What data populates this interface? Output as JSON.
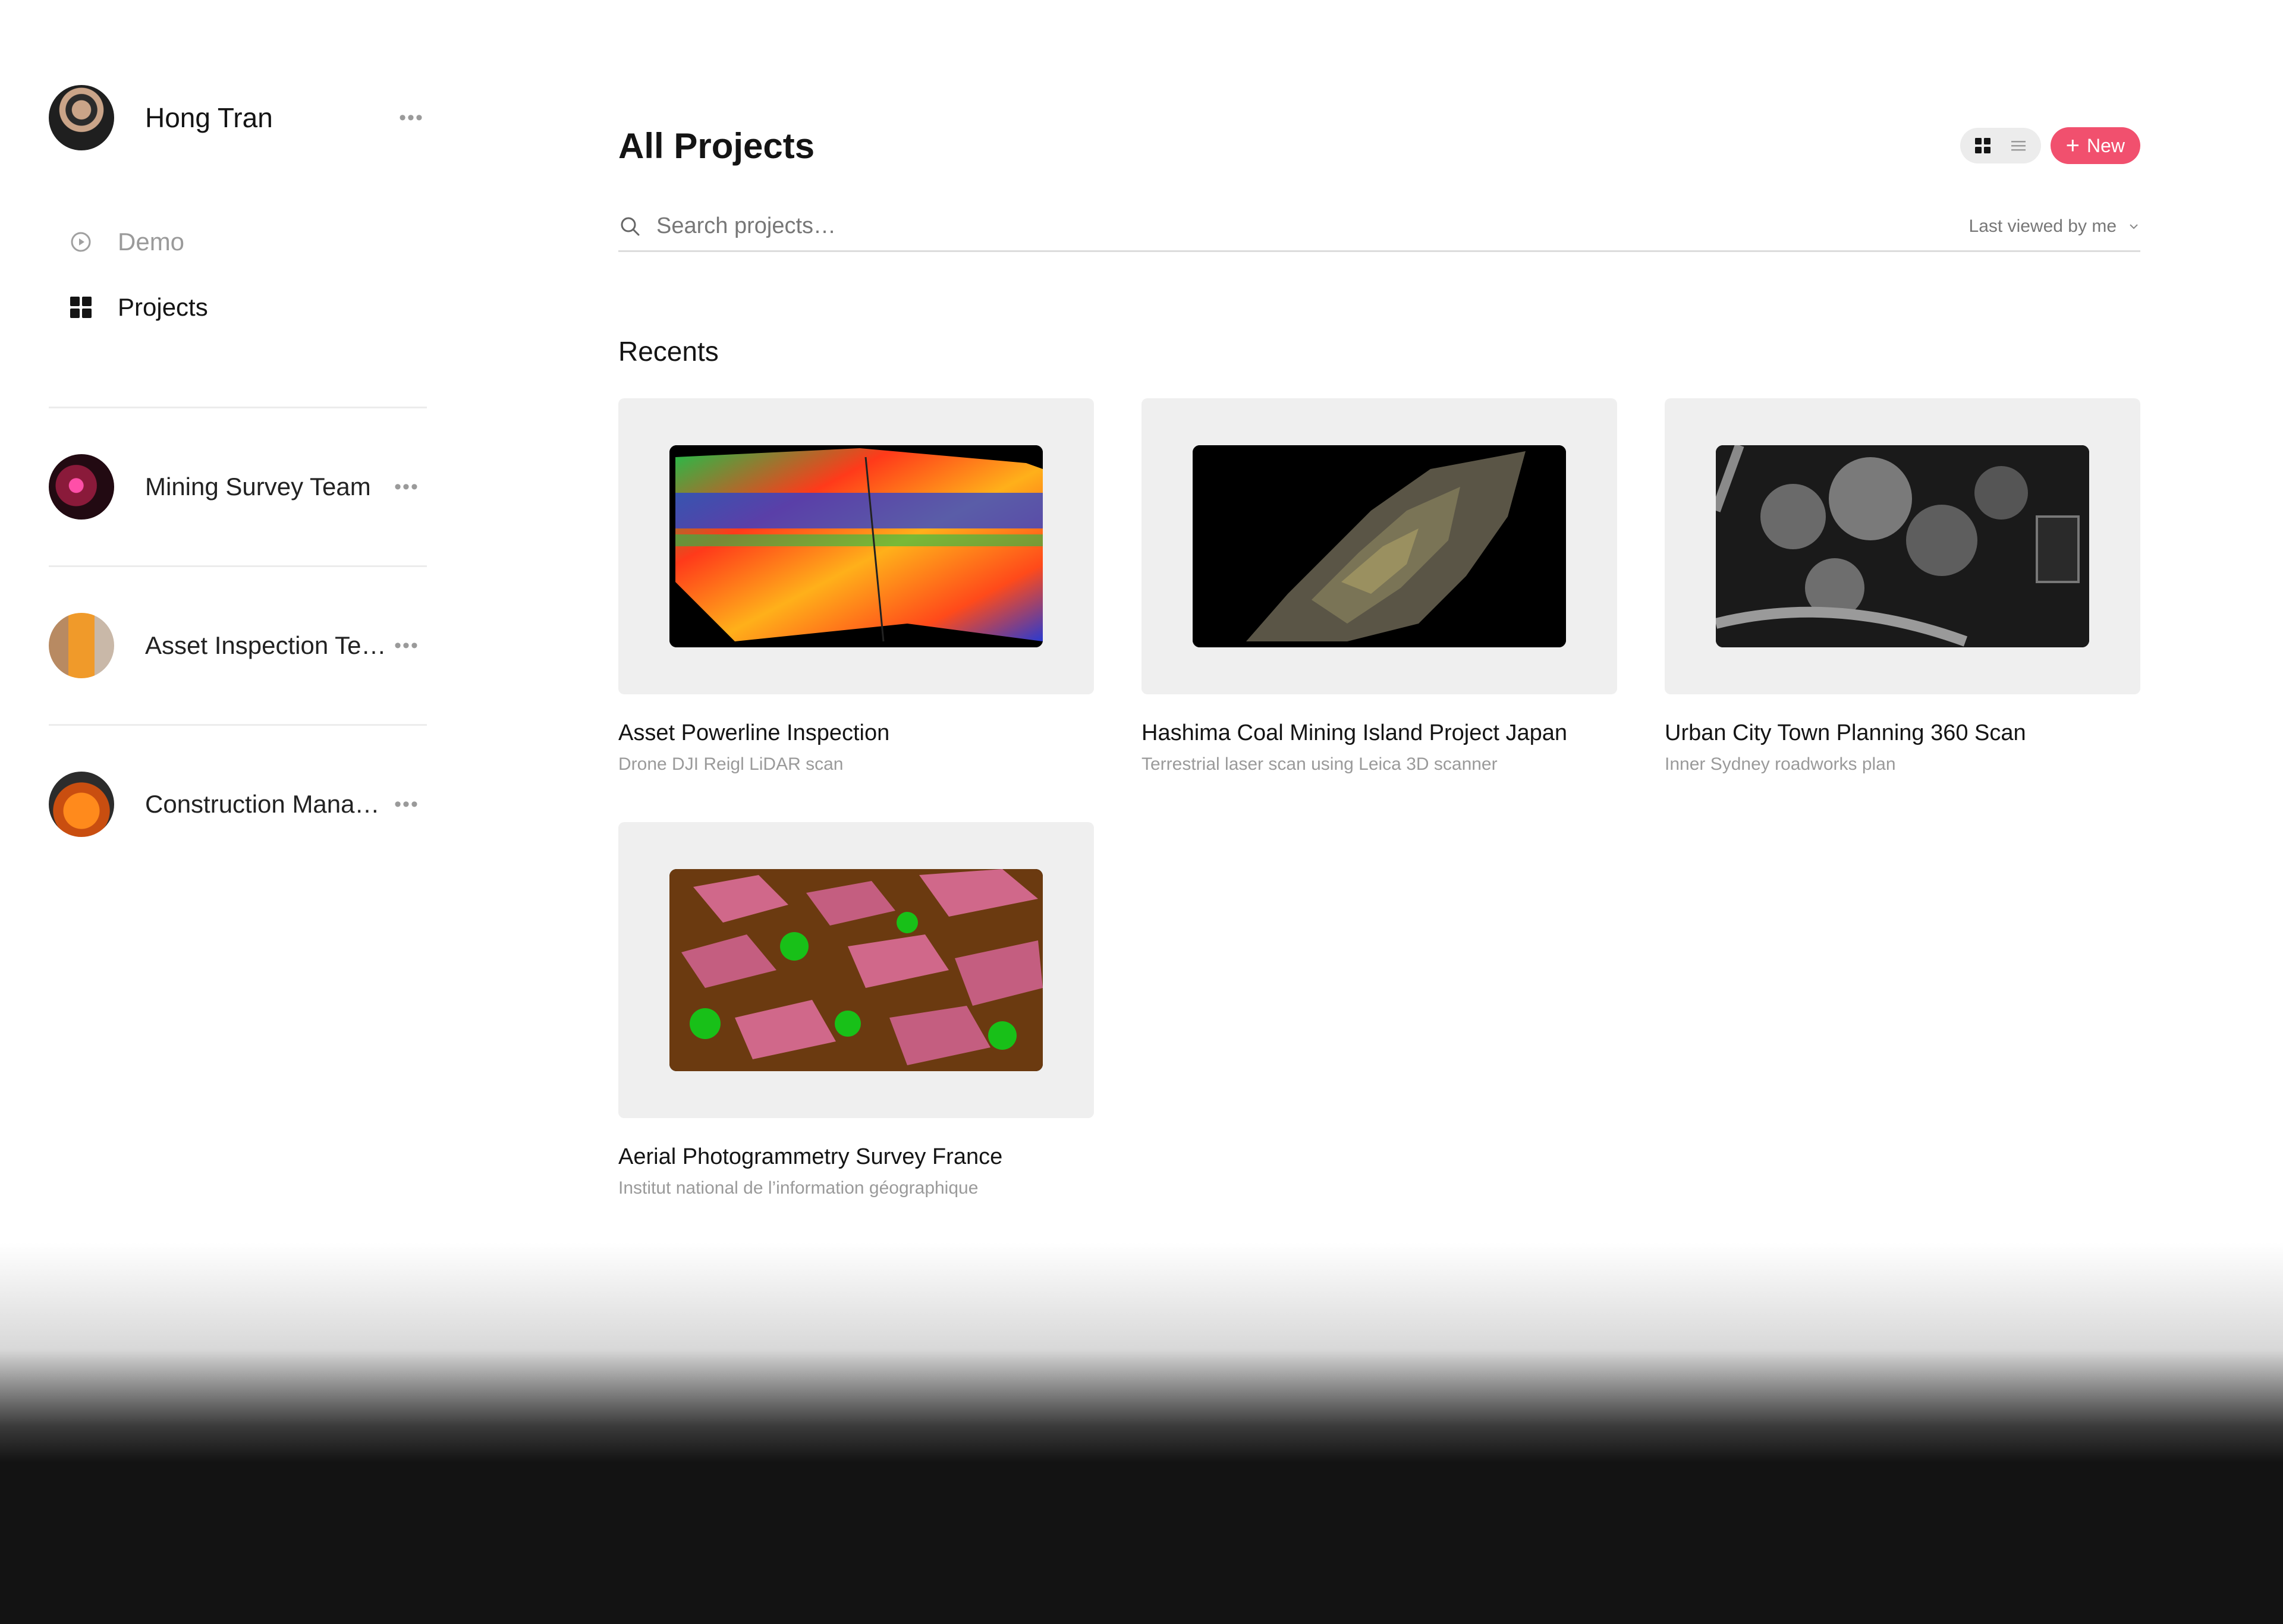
{
  "user": {
    "name": "Hong Tran"
  },
  "nav": [
    {
      "label": "Demo",
      "icon": "play-circle-icon"
    },
    {
      "label": "Projects",
      "icon": "grid-icon"
    }
  ],
  "teams": [
    {
      "name": "Mining Survey Team"
    },
    {
      "name": "Asset Inspection Team"
    },
    {
      "name": "Construction Management"
    }
  ],
  "header": {
    "title": "All Projects",
    "new_label": "New"
  },
  "search": {
    "placeholder": "Search projects…",
    "sort_label": "Last viewed by me"
  },
  "recents": {
    "title": "Recents",
    "projects": [
      {
        "title": "Asset Powerline Inspection",
        "subtitle": "Drone DJI Reigl LiDAR scan"
      },
      {
        "title": "Hashima Coal Mining Island Project Japan",
        "subtitle": "Terrestrial laser scan using Leica 3D scanner"
      },
      {
        "title": "Urban City Town Planning 360 Scan",
        "subtitle": "Inner Sydney roadworks plan"
      },
      {
        "title": "Aerial Photogrammetry Survey France",
        "subtitle": "Institut national de l’information géographique"
      }
    ]
  },
  "colors": {
    "accent": "#f1506e",
    "muted": "#9a9a9a",
    "divider": "#ececec"
  }
}
